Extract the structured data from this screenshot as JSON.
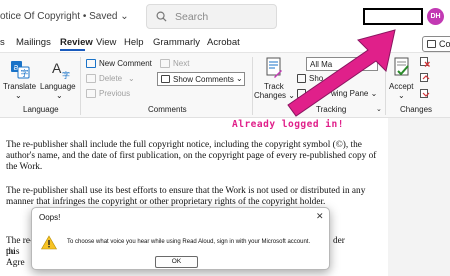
{
  "titlebar": {
    "doc_title": "otice Of Copyright • Saved ⌄",
    "search_placeholder": "Search",
    "avatar_initials": "DH"
  },
  "tabs": [
    {
      "label": "s"
    },
    {
      "label": "Mailings"
    },
    {
      "label": "Review"
    },
    {
      "label": "View"
    },
    {
      "label": "Help"
    },
    {
      "label": "Grammarly"
    },
    {
      "label": "Acrobat"
    }
  ],
  "comments_button": {
    "label": "Co"
  },
  "ribbon": {
    "language_group": {
      "translate_label": "Translate",
      "translate_chevron": "⌄",
      "language_label": "Language",
      "language_chevron": "⌄",
      "group_label": "Language"
    },
    "comments_group": {
      "new_comment": "New Comment",
      "delete": "Delete",
      "delete_chevron": "⌄",
      "previous": "Previous",
      "next": "Next",
      "show_comments": "Show Comments",
      "show_comments_chevron": "⌄",
      "group_label": "Comments"
    },
    "tracking_group": {
      "track_label_line1": "Track",
      "track_label_line2": "Changes ⌄",
      "all_markup": "All Ma",
      "show_partial": "Sho",
      "reviewing_pane": "wing Pane ⌄",
      "group_label": "Tracking",
      "launcher": "⌄"
    },
    "changes_group": {
      "accept_label": "Accept",
      "accept_chevron": "⌄",
      "group_label": "Changes"
    }
  },
  "document": {
    "para1": "The re-publisher shall include the full copyright notice, including the copyright symbol (©), the author's name, and the date of first publication, on the copyright page of every re-published copy of the Work.",
    "para2": "The re-publisher shall use its best efforts to ensure that the Work is not used or distributed in any manner that infringes the copyright or other proprietary rights of the copyright holder.",
    "para3_left": "The re-pu",
    "para3_right": "der",
    "para3_line2": "this Agre"
  },
  "annotation": {
    "text": "Already logged in!",
    "color": "#e0208a"
  },
  "dialog": {
    "title": "Oops!",
    "close": "✕",
    "message": "To choose what voice you hear while using Read Aloud, sign in with your Microsoft account.",
    "ok_label": "OK"
  },
  "colors": {
    "accent": "#185abd",
    "avatar": "#c239b3",
    "arrow": "#e0208a"
  }
}
